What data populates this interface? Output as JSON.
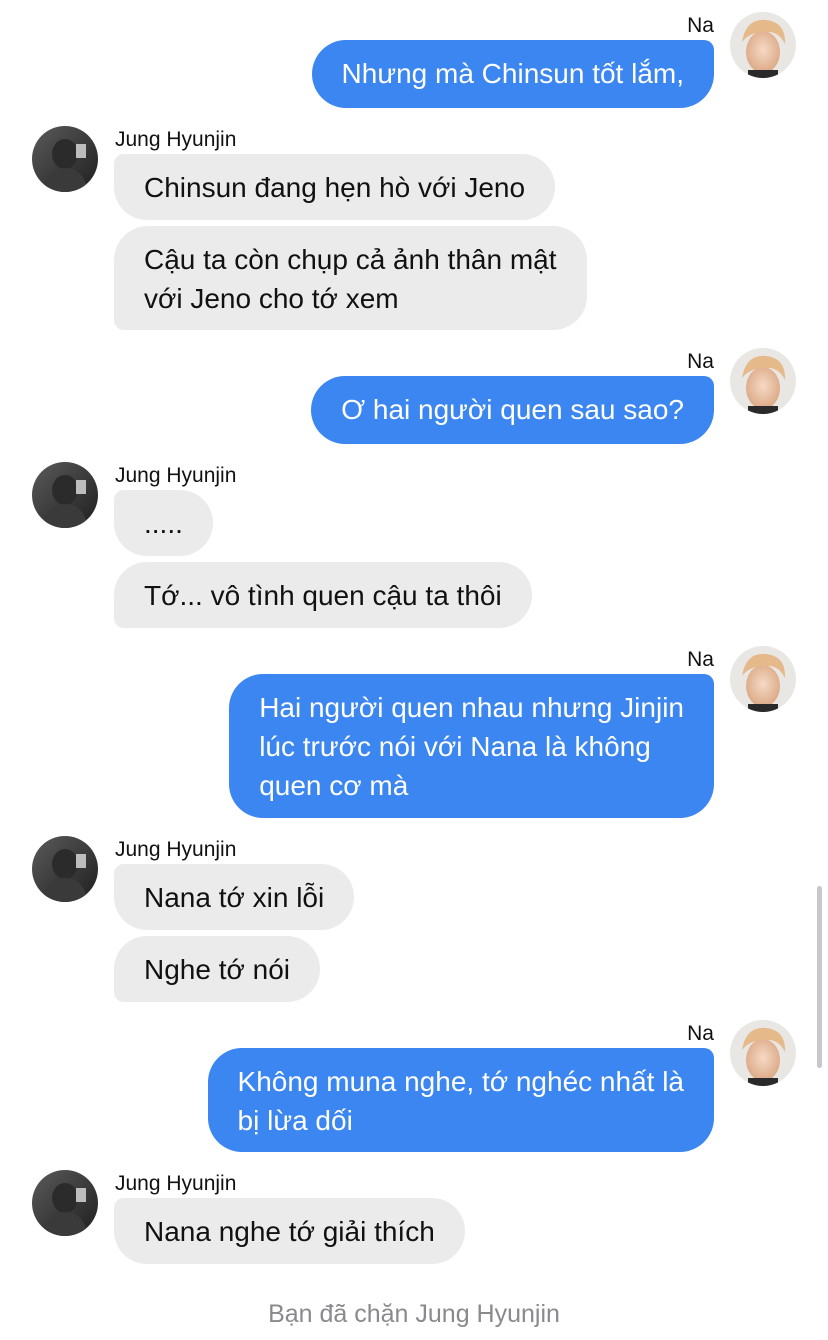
{
  "participants": {
    "me": {
      "name": "Na"
    },
    "them": {
      "name": "Jung Hyunjin"
    }
  },
  "messages": [
    {
      "from": "me",
      "sender_label": "Na",
      "text": "Nhưng mà Chinsun tốt lắm,"
    },
    {
      "from": "them",
      "sender_label": "Jung Hyunjin",
      "text": "Chinsun đang hẹn hò với Jeno"
    },
    {
      "from": "them",
      "text": "Cậu ta còn chụp cả ảnh thân mật\nvới Jeno cho tớ xem"
    },
    {
      "from": "me",
      "sender_label": "Na",
      "text": "Ơ hai người quen sau sao?"
    },
    {
      "from": "them",
      "sender_label": "Jung Hyunjin",
      "text": "....."
    },
    {
      "from": "them",
      "text": "Tớ... vô tình quen cậu ta thôi"
    },
    {
      "from": "me",
      "sender_label": "Na",
      "text": "Hai người quen nhau nhưng Jinjin\nlúc trước nói với Nana là không\nquen cơ mà"
    },
    {
      "from": "them",
      "sender_label": "Jung Hyunjin",
      "text": "Nana tớ xin lỗi"
    },
    {
      "from": "them",
      "text": "Nghe tớ nói"
    },
    {
      "from": "me",
      "sender_label": "Na",
      "text": "Không muna nghe, tớ nghéc nhất là\nbị lừa dối"
    },
    {
      "from": "them",
      "sender_label": "Jung Hyunjin",
      "text": "Nana nghe tớ giải thích"
    }
  ],
  "system_note": "Bạn đã chặn Jung Hyunjin",
  "colors": {
    "outgoing_bubble": "#3b86f0",
    "incoming_bubble": "#ebebeb",
    "system_text": "#8a8a8e"
  }
}
